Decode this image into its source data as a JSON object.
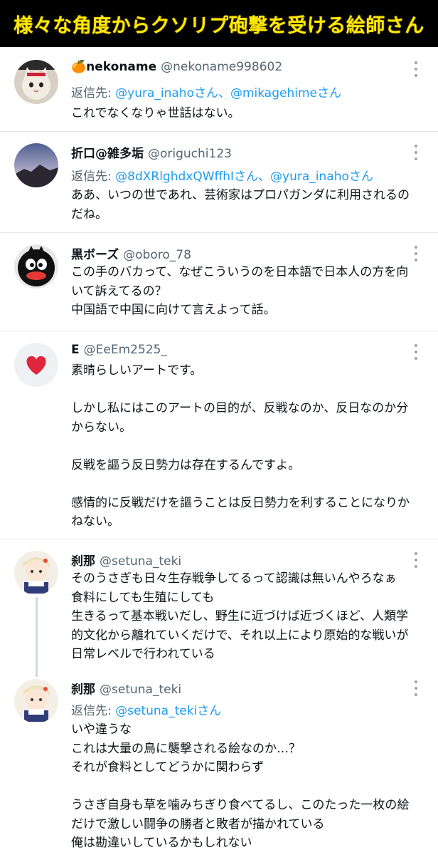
{
  "banner": {
    "title": "様々な角度からクソリプ砲撃を受ける絵師さん"
  },
  "tweets": [
    {
      "emoji": "🍊",
      "name": "nekoname",
      "handle": "@nekoname998602",
      "reply_prefix": "返信先: ",
      "reply_to": "@yura_inahoさん、@mikagehimeさん",
      "text": "これでなくなりゃ世話はない。"
    },
    {
      "name": "折口@雑多垢",
      "handle": "@origuchi123",
      "reply_prefix": "返信先: ",
      "reply_to": "@8dXRlghdxQWffhIさん、@yura_inahoさん",
      "text": "ああ、いつの世であれ、芸術家はプロパガンダに利用されるの\nだね。"
    },
    {
      "name": "黒ボーズ",
      "handle": "@oboro_78",
      "text": "この手のバカって、なぜこういうのを日本語で日本人の方を向\nいて訴えてるの？\n中国語で中国に向けて言えよって話。"
    },
    {
      "name": "E",
      "handle": "@EeEm2525_",
      "text": "素晴らしいアートです。\n\nしかし私にはこのアートの目的が、反戦なのか、反日なのか分\nからない。\n\n反戦を謳う反日勢力は存在するんですよ。\n\n感情的に反戦だけを謳うことは反日勢力を利することになりか\nねない。"
    },
    {
      "name": "刹那",
      "handle": "@setuna_teki",
      "text": "そのうさぎも日々生存戦争してるって認識は無いんやろなぁ\n食料にしても生殖にしても\n生きるって基本戦いだし、野生に近づけば近づくほど、人類学\n的文化から離れていくだけで、それ以上により原始的な戦いが\n日常レベルで行われている"
    },
    {
      "name": "刹那",
      "handle": "@setuna_teki",
      "reply_prefix": "返信先: ",
      "reply_to": "@setuna_tekiさん",
      "text": "いや違うな\nこれは大量の鳥に襲撃される絵なのか…？\nそれが食料としてどうかに関わらず\n\nうさぎ自身も草を噛みちぎり食べてるし、このたった一枚の絵\nだけで激しい闘争の勝者と敗者が描かれている\n俺は勘違いしているかもしれない"
    }
  ],
  "colors": {
    "banner_bg": "#000000",
    "banner_text": "#ffea00",
    "link": "#1d9bf0",
    "secondary": "#536471",
    "primary": "#0f1419"
  },
  "icons": [
    "more-icon",
    "heart-icon",
    "avatar-images"
  ]
}
